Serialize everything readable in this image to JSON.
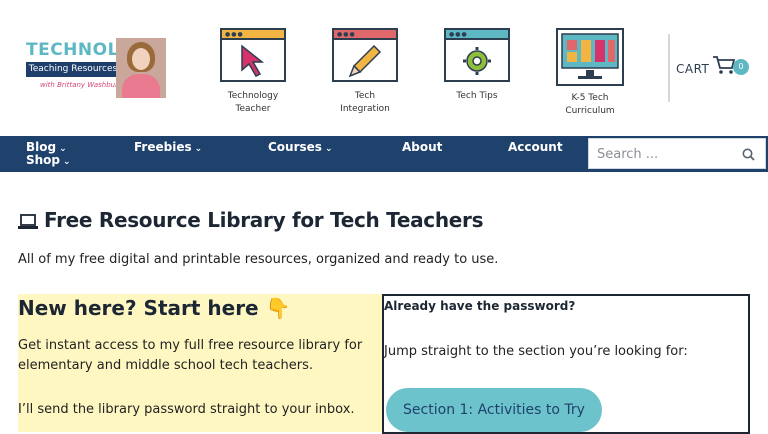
{
  "header": {
    "logo": {
      "line1": "TECHNOLOGY",
      "line2": "Teaching Resources",
      "line3": "with Brittany Washburn"
    },
    "nav_icons": [
      {
        "label": "Technology Teacher",
        "icon": "cursor-arrow-icon",
        "bar_color": "#f2b544"
      },
      {
        "label": "Tech Integration",
        "icon": "pencil-icon",
        "bar_color": "#e0686b"
      },
      {
        "label": "Tech Tips",
        "icon": "gear-icon",
        "bar_color": "#5db8c4"
      },
      {
        "label": "K-5 Tech Curriculum",
        "icon": "monitor-bars-icon",
        "bar_color": "#5db8c4"
      }
    ],
    "cart": {
      "label": "CART",
      "count": "0"
    }
  },
  "navbar": {
    "items": [
      {
        "label": "Blog",
        "has_dropdown": true
      },
      {
        "label": "Shop",
        "has_dropdown": true
      },
      {
        "label": "Freebies",
        "has_dropdown": true
      },
      {
        "label": "Courses",
        "has_dropdown": true
      },
      {
        "label": "About",
        "has_dropdown": false
      },
      {
        "label": "Account",
        "has_dropdown": false
      }
    ],
    "search_placeholder": "Search ..."
  },
  "main": {
    "title": "Free Resource Library for Tech Teachers",
    "intro": "All of my free digital and printable resources, organized and ready to use.",
    "left_panel": {
      "heading": "New here? Start here 👇",
      "paragraph1": "Get instant access to my full free resource library for elementary and middle school tech teachers.",
      "paragraph2": "I’ll send the library password straight to your inbox."
    },
    "right_panel": {
      "heading": "Already have the password?",
      "subtext": "Jump straight to the section you’re looking for:",
      "button": "Section 1: Activities to Try"
    }
  },
  "colors": {
    "navbar": "#1f426d",
    "accent": "#5db8c4",
    "highlight": "#fff7c2"
  }
}
